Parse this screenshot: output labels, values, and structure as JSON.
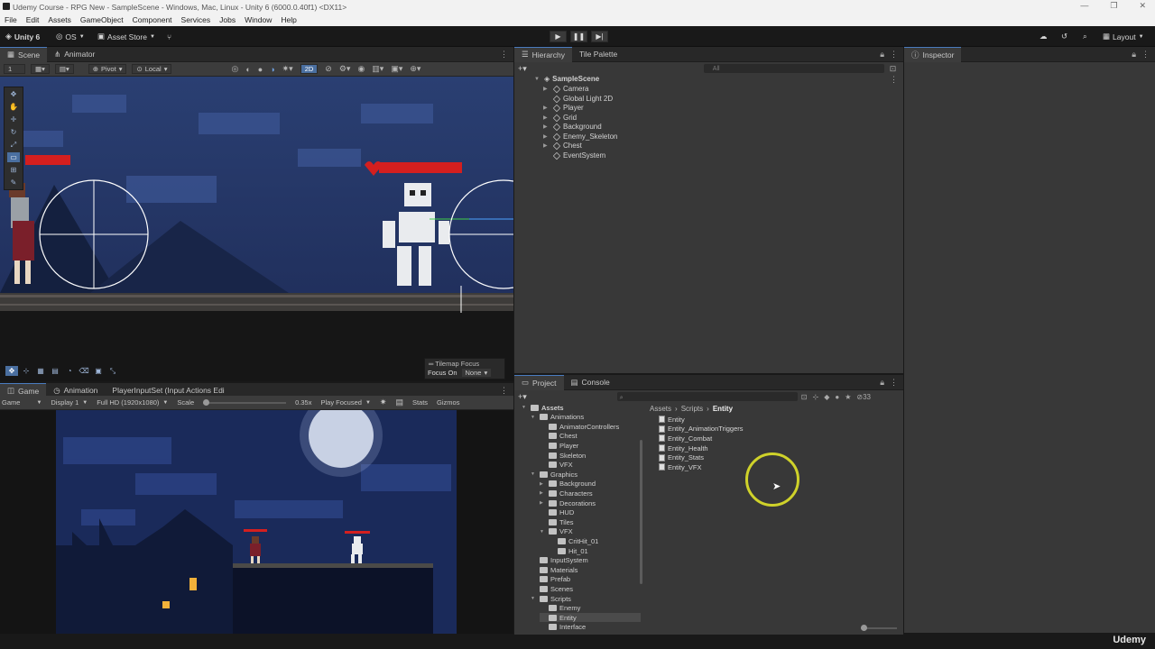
{
  "window": {
    "title": "Udemy Course - RPG New - SampleScene - Windows, Mac, Linux - Unity 6 (6000.0.40f1) <DX11>",
    "controls": [
      "—",
      "❐",
      "✕"
    ]
  },
  "menu": [
    "File",
    "Edit",
    "Assets",
    "GameObject",
    "Component",
    "Services",
    "Jobs",
    "Window",
    "Help"
  ],
  "toolbar": {
    "account": "Unity 6",
    "os_label": "OS",
    "asset_store": "Asset Store",
    "layout": "Layout"
  },
  "scene_panel": {
    "tabs": [
      "Scene",
      "Animator"
    ],
    "layer_value": "1",
    "pivot": "Pivot",
    "local": "Local",
    "mode_2d": "2D",
    "tilemap_focus_title": "Tilemap Focus",
    "focus_on_label": "Focus On",
    "focus_on_value": "None"
  },
  "hierarchy": {
    "tabs": [
      "Hierarchy",
      "Tile Palette"
    ],
    "search_placeholder": "All",
    "scene_name": "SampleScene",
    "items": [
      "Camera",
      "Global Light 2D",
      "Player",
      "Grid",
      "Background",
      "Enemy_Skeleton",
      "Chest",
      "EventSystem"
    ]
  },
  "inspector": {
    "tab": "Inspector"
  },
  "game_panel": {
    "tabs": [
      "Game",
      "Animation",
      "PlayerInputSet (Input Actions Edi"
    ],
    "mode": "Game",
    "display": "Display 1",
    "resolution": "Full HD (1920x1080)",
    "scale_label": "Scale",
    "scale_value": "0.35x",
    "play_mode": "Play Focused",
    "stats": "Stats",
    "gizmos": "Gizmos"
  },
  "project": {
    "tabs": [
      "Project",
      "Console"
    ],
    "item_count": "33",
    "tree": [
      {
        "label": "Assets",
        "depth": 0,
        "open": true,
        "bold": true
      },
      {
        "label": "Animations",
        "depth": 1,
        "open": true
      },
      {
        "label": "AnimatorControllers",
        "depth": 2
      },
      {
        "label": "Chest",
        "depth": 2
      },
      {
        "label": "Player",
        "depth": 2
      },
      {
        "label": "Skeleton",
        "depth": 2
      },
      {
        "label": "VFX",
        "depth": 2
      },
      {
        "label": "Graphics",
        "depth": 1,
        "open": true
      },
      {
        "label": "Background",
        "depth": 2,
        "closed": true
      },
      {
        "label": "Characters",
        "depth": 2,
        "closed": true
      },
      {
        "label": "Decorations",
        "depth": 2,
        "closed": true
      },
      {
        "label": "HUD",
        "depth": 2
      },
      {
        "label": "Tiles",
        "depth": 2
      },
      {
        "label": "VFX",
        "depth": 2,
        "open": true
      },
      {
        "label": "CritHit_01",
        "depth": 3
      },
      {
        "label": "Hit_01",
        "depth": 3
      },
      {
        "label": "InputSystem",
        "depth": 1
      },
      {
        "label": "Materials",
        "depth": 1
      },
      {
        "label": "Prefab",
        "depth": 1
      },
      {
        "label": "Scenes",
        "depth": 1
      },
      {
        "label": "Scripts",
        "depth": 1,
        "open": true
      },
      {
        "label": "Enemy",
        "depth": 2
      },
      {
        "label": "Entity",
        "depth": 2,
        "selected": true
      },
      {
        "label": "Interface",
        "depth": 2
      }
    ],
    "breadcrumb": [
      "Assets",
      "Scripts",
      "Entity"
    ],
    "files": [
      "Entity",
      "Entity_AnimationTriggers",
      "Entity_Combat",
      "Entity_Health",
      "Entity_Stats",
      "Entity_VFX"
    ]
  },
  "watermark": "Udemy",
  "colors": {
    "accent": "#4a7cc0",
    "health_bar": "#d41f1f",
    "cursor_ring": "#d4d41f"
  }
}
